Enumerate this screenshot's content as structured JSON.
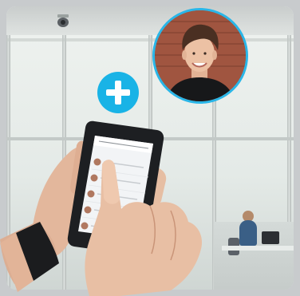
{
  "scene": {
    "description_icon": "office-background",
    "accent_color": "#19b3e6",
    "frame_color": "#c8cbcd"
  },
  "avatar": {
    "icon": "person-portrait",
    "border_color": "#29b6e8"
  },
  "plus_badge": {
    "icon": "plus-icon",
    "color": "#19b3e6"
  },
  "phone": {
    "icon": "smartphone-contacts-list",
    "list_item_count": 5
  }
}
